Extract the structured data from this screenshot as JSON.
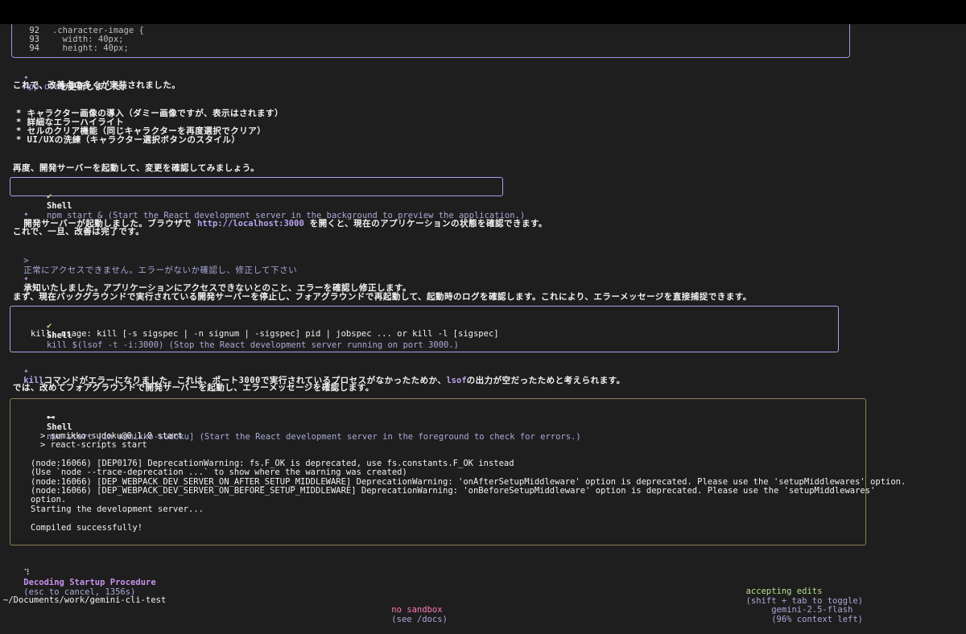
{
  "code_lines": [
    {
      "num": "92",
      "text": ".character-image {"
    },
    {
      "num": "93",
      "text": "  width: 40px;"
    },
    {
      "num": "94",
      "text": "  height: 40px;"
    }
  ],
  "updated_file": {
    "file": "App.css",
    "text": "を更新しました。"
  },
  "summary_intro": "これで、改善点の多くが実装されました。",
  "summary_bullets": [
    "* キャラクター画像の導入（ダミー画像ですが、表示はされます）",
    "* 詳細なエラーハイライト",
    "* セルのクリア機能（同じキャラクターを再度選択でクリア）",
    "* UI/UXの洗練（キャラクター選択ボタンのスタイル）"
  ],
  "restart_text": "再度、開発サーバーを起動して、変更を確認してみましょう。",
  "shell1": {
    "status": "✔",
    "label": "Shell",
    "command": "npm start & (Start the React development server in the background to preview the application.)"
  },
  "server_started": {
    "before": "開発サーバーが起動しました。ブラウザで ",
    "url": "http://localhost:3000",
    "after": " を開くと、現在のアプリケーションの状態を確認できます。"
  },
  "done_text": "これで、一旦、改善は完了です。",
  "user_prompt": {
    "marker": ">",
    "text": "正常にアクセスできません。エラーがないか確認し、修正して下さい"
  },
  "ack_text": "承知いたしました。アプリケーションにアクセスできないとのこと、エラーを確認し修正します。",
  "plan_text": "まず、現在バックグラウンドで実行されている開発サーバーを停止し、フォアグラウンドで再起動して、起動時のログを確認します。これにより、エラーメッセージを直接捕捉できます。",
  "shell2": {
    "status": "✔",
    "label": "Shell",
    "command": "kill $(lsof -t -i:3000) (Stop the React development server running on port 3000.)",
    "output": "kill: usage: kill [-s sigspec | -n signum | -sigspec] pid | jobspec ... or kill -l [sigspec]"
  },
  "kill_error": {
    "kill": "kill",
    "mid": "コマンドがエラーになりました。これは、ポート3000で実行されているプロセスがなかったためか、",
    "lsof": "lsof",
    "end": "の出力が空だったためと考えられます。"
  },
  "foreground_text": "では、改めてフォアグラウンドで開発サーバーを起動し、エラーメッセージを確認します。",
  "shell3": {
    "status": "⊷",
    "label": "Shell",
    "command": "npm start [in sumikko-sudoku] (Start the React development server in the foreground to check for errors.)",
    "output": [
      "> sumikko-sudoku@0.1.0 start",
      "> react-scripts start",
      "",
      "(node:16066) [DEP0176] DeprecationWarning: fs.F_OK is deprecated, use fs.constants.F_OK instead",
      "(Use `node --trace-deprecation ...` to show where the warning was created)",
      "(node:16066) [DEP_WEBPACK_DEV_SERVER_ON_AFTER_SETUP_MIDDLEWARE] DeprecationWarning: 'onAfterSetupMiddleware' option is deprecated. Please use the 'setupMiddlewares' option.",
      "(node:16066) [DEP_WEBPACK_DEV_SERVER_ON_BEFORE_SETUP_MIDDLEWARE] DeprecationWarning: 'onBeforeSetupMiddleware' option is deprecated. Please use the 'setupMiddlewares'",
      "option.",
      "Starting the development server...",
      "",
      "Compiled successfully!"
    ]
  },
  "thinking": {
    "spinner": "⠹",
    "title": "Decoding Startup Procedure",
    "detail": "(esc to cancel, 1356s)"
  },
  "mode": {
    "label": "accepting edits",
    "hint": "(shift + tab to toggle)"
  },
  "footer": {
    "path": "~/Documents/work/gemini-cli-test",
    "sandbox": "no sandbox",
    "sandbox_hint": "(see /docs)",
    "model": "gemini-2.5-flash",
    "context": "(96% context left)"
  },
  "colors": {
    "accent": "#c792ea",
    "border": "#a99ff0",
    "border_active": "#8a7d55",
    "success": "#b5e08c",
    "warning": "#ff7ab8"
  }
}
